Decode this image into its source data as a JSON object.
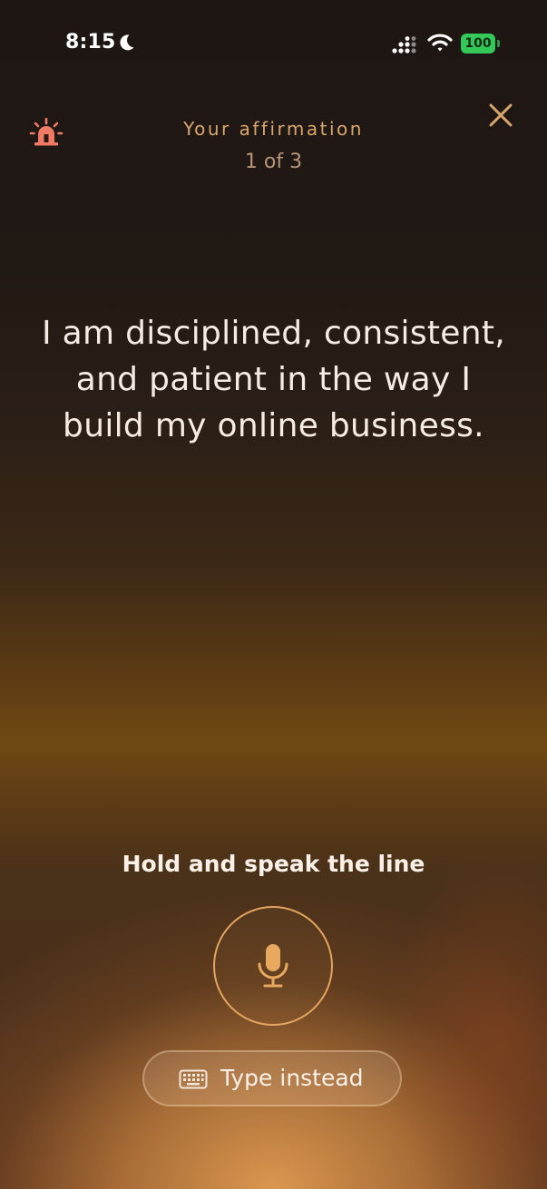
{
  "status_bar": {
    "time": "8:15",
    "battery": "100",
    "icons": [
      "moon-icon",
      "signal-icon",
      "wifi-icon",
      "battery-icon"
    ]
  },
  "header": {
    "title": "Your affirmation",
    "counter": "1 of 3",
    "left_icon": "alarm-siren-icon",
    "right_icon": "close-icon"
  },
  "affirmation": {
    "text": "I am disciplined, consistent, and patient in the way I build my online business."
  },
  "controls": {
    "hint": "Hold and speak the line",
    "mic_icon": "microphone-icon",
    "type_button_label": "Type instead",
    "type_button_icon": "keyboard-icon"
  },
  "colors": {
    "accent": "#d9a66d",
    "alarm": "#f07a63",
    "mic": "#e3a45e",
    "battery": "#34c759"
  }
}
